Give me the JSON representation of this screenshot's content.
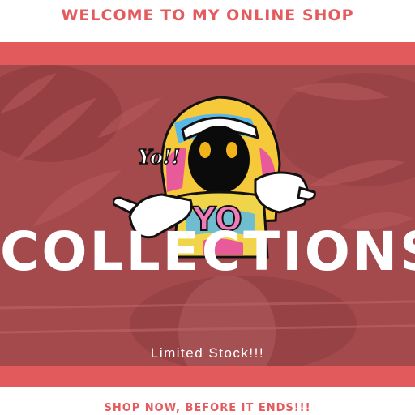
{
  "header": {
    "welcome_text": "WELCOME TO MY ONLINE SHOP"
  },
  "banner": {
    "title": "COLLECTIONS",
    "subtitle": "Limited Stock!!!",
    "sticker_speech": "Yo!!",
    "sticker_text": "YO"
  },
  "footer": {
    "cta_text": "SHOP NOW, BEFORE IT ENDS!!!"
  },
  "colors": {
    "accent": "#e35b5d",
    "banner_outer": "#e35a5c",
    "banner_overlay": "#a44a4d",
    "text_on_banner": "#ffffff"
  }
}
